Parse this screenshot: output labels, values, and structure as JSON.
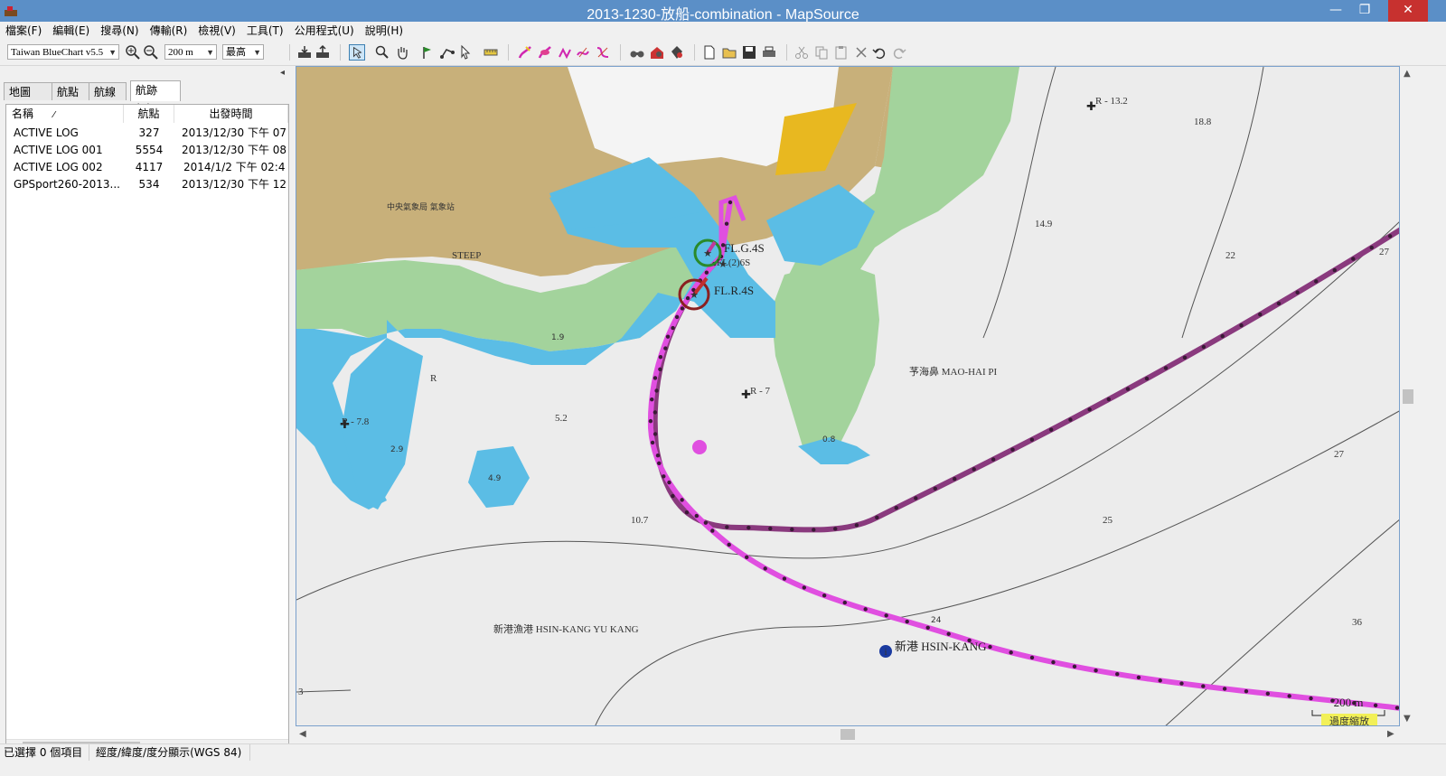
{
  "window": {
    "title": "2013-1230-放船-combination - MapSource",
    "minimize": "—",
    "maximize": "❐",
    "close": "✕"
  },
  "menu": [
    "檔案(F)",
    "編輯(E)",
    "搜尋(N)",
    "傳輸(R)",
    "檢視(V)",
    "工具(T)",
    "公用程式(U)",
    "說明(H)"
  ],
  "toolbar": {
    "map_product": "Taiwan BlueChart v5.5",
    "zoom_scale": "200 m",
    "detail_level": "最高"
  },
  "tabs": [
    "地圖 (2)",
    "航點",
    "航線",
    "航跡 (4)"
  ],
  "table": {
    "headers": [
      "名稱",
      "航點",
      "出發時間"
    ],
    "sort_indicator": "⁄",
    "rows": [
      [
        "ACTIVE LOG",
        "327",
        "2013/12/30 下午 07"
      ],
      [
        "ACTIVE LOG 001",
        "5554",
        "2013/12/30 下午 08"
      ],
      [
        "ACTIVE LOG 002",
        "4117",
        "2014/1/2 下午 02:4"
      ],
      [
        "GPSport260-2013...",
        "534",
        "2013/12/30 下午 12"
      ]
    ]
  },
  "map": {
    "labels": {
      "station": "中央氣象局 氣象站",
      "steep": "STEEP",
      "light_g": "FL.G.4S",
      "light_2": "FL(2)6S",
      "light_r": "FL.R.4S",
      "maohai": "芧海鼻 MAO-HAI PI",
      "hsinkang_yukang": "新港漁港 HSIN-KANG YU KANG",
      "hsinkang": "新港 HSIN-KANG",
      "r13": "R - 13.2",
      "r78": "R - 7.8",
      "r7": "R - 7",
      "r_bay": "R"
    },
    "depths": [
      "18.8",
      "14.9",
      "22",
      "27",
      "1.9",
      "5.2",
      "2.9",
      "4.9",
      "0.8",
      "27",
      "10.7",
      "25",
      "24",
      "36",
      "3"
    ],
    "scale_text": "200 m",
    "overzoom": "過度縮放",
    "colors": {
      "land": "#c8b07a",
      "green": "#a3d39c",
      "water_shallow": "#5bbde5",
      "sea": "#ececec",
      "track": "#e04fe0",
      "track_dark": "#8a3a7e"
    }
  },
  "status": {
    "selected": "已選擇 0 個項目",
    "coords": "經度/緯度/度分顯示(WGS 84)"
  }
}
